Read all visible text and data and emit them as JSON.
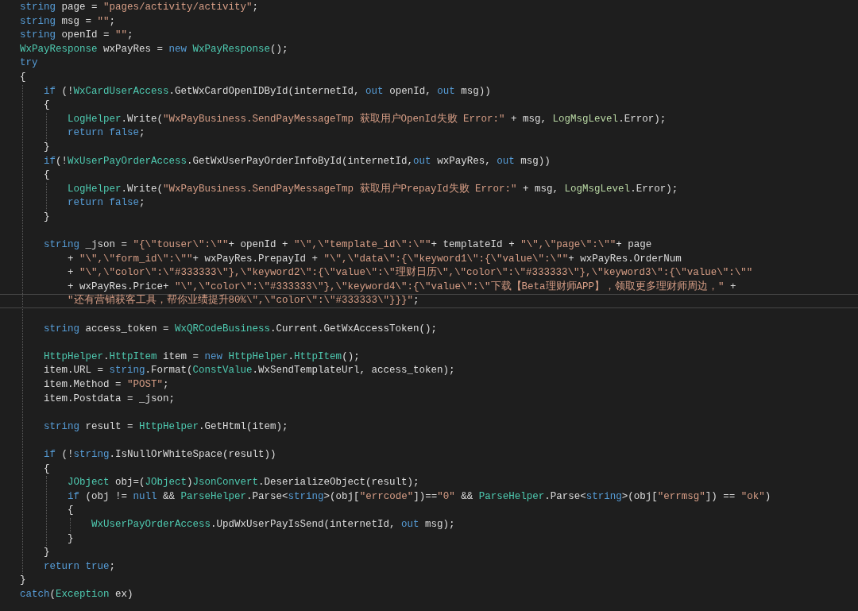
{
  "editor": {
    "lines": [
      {
        "kind": "code",
        "tokens": [
          {
            "kind": "kw",
            "text": "string"
          },
          {
            "kind": "plain",
            "text": " page = "
          },
          {
            "kind": "str",
            "text": "\"pages/activity/activity\""
          },
          {
            "kind": "plain",
            "text": ";"
          }
        ]
      },
      {
        "kind": "code",
        "tokens": [
          {
            "kind": "kw",
            "text": "string"
          },
          {
            "kind": "plain",
            "text": " msg = "
          },
          {
            "kind": "str",
            "text": "\"\""
          },
          {
            "kind": "plain",
            "text": ";"
          }
        ]
      },
      {
        "kind": "code",
        "tokens": [
          {
            "kind": "kw",
            "text": "string"
          },
          {
            "kind": "plain",
            "text": " openId = "
          },
          {
            "kind": "str",
            "text": "\"\""
          },
          {
            "kind": "plain",
            "text": ";"
          }
        ]
      },
      {
        "kind": "code",
        "tokens": [
          {
            "kind": "type",
            "text": "WxPayResponse"
          },
          {
            "kind": "plain",
            "text": " wxPayRes = "
          },
          {
            "kind": "kw",
            "text": "new "
          },
          {
            "kind": "type",
            "text": "WxPayResponse"
          },
          {
            "kind": "plain",
            "text": "();"
          }
        ]
      },
      {
        "kind": "code",
        "tokens": [
          {
            "kind": "kw",
            "text": "try"
          }
        ]
      },
      {
        "kind": "code",
        "tokens": [
          {
            "kind": "plain",
            "text": "{"
          }
        ],
        "guide": true,
        "children": [
          {
            "kind": "code",
            "tokens": [
              {
                "kind": "kw",
                "text": "if"
              },
              {
                "kind": "plain",
                "text": " (!"
              },
              {
                "kind": "type",
                "text": "WxCardUserAccess"
              },
              {
                "kind": "plain",
                "text": ".GetWxCardOpenIDById(internetId, "
              },
              {
                "kind": "kw",
                "text": "out"
              },
              {
                "kind": "plain",
                "text": " openId, "
              },
              {
                "kind": "kw",
                "text": "out"
              },
              {
                "kind": "plain",
                "text": " msg))"
              }
            ]
          },
          {
            "kind": "code",
            "tokens": [
              {
                "kind": "plain",
                "text": "{"
              }
            ],
            "guide": true,
            "children": [
              {
                "kind": "code",
                "tokens": [
                  {
                    "kind": "type",
                    "text": "LogHelper"
                  },
                  {
                    "kind": "plain",
                    "text": ".Write("
                  },
                  {
                    "kind": "str",
                    "text": "\"WxPayBusiness.SendPayMessageTmp 获取用户OpenId失败 Error:\""
                  },
                  {
                    "kind": "plain",
                    "text": " + msg, "
                  },
                  {
                    "kind": "enum",
                    "text": "LogMsgLevel"
                  },
                  {
                    "kind": "plain",
                    "text": ".Error);"
                  }
                ]
              },
              {
                "kind": "code",
                "tokens": [
                  {
                    "kind": "kw",
                    "text": "return false"
                  },
                  {
                    "kind": "plain",
                    "text": ";"
                  }
                ]
              }
            ]
          },
          {
            "kind": "code",
            "tokens": [
              {
                "kind": "plain",
                "text": "}"
              }
            ]
          },
          {
            "kind": "code",
            "tokens": [
              {
                "kind": "kw",
                "text": "if"
              },
              {
                "kind": "plain",
                "text": "(!"
              },
              {
                "kind": "type",
                "text": "WxUserPayOrderAccess"
              },
              {
                "kind": "plain",
                "text": ".GetWxUserPayOrderInfoById(internetId,"
              },
              {
                "kind": "kw",
                "text": "out"
              },
              {
                "kind": "plain",
                "text": " wxPayRes, "
              },
              {
                "kind": "kw",
                "text": "out"
              },
              {
                "kind": "plain",
                "text": " msg))"
              }
            ]
          },
          {
            "kind": "code",
            "tokens": [
              {
                "kind": "plain",
                "text": "{"
              }
            ],
            "guide": true,
            "children": [
              {
                "kind": "code",
                "tokens": [
                  {
                    "kind": "type",
                    "text": "LogHelper"
                  },
                  {
                    "kind": "plain",
                    "text": ".Write("
                  },
                  {
                    "kind": "str",
                    "text": "\"WxPayBusiness.SendPayMessageTmp 获取用户PrepayId失败 Error:\""
                  },
                  {
                    "kind": "plain",
                    "text": " + msg, "
                  },
                  {
                    "kind": "enum",
                    "text": "LogMsgLevel"
                  },
                  {
                    "kind": "plain",
                    "text": ".Error);"
                  }
                ]
              },
              {
                "kind": "code",
                "tokens": [
                  {
                    "kind": "kw",
                    "text": "return false"
                  },
                  {
                    "kind": "plain",
                    "text": ";"
                  }
                ]
              }
            ]
          },
          {
            "kind": "code",
            "tokens": [
              {
                "kind": "plain",
                "text": "}"
              }
            ]
          },
          {
            "kind": "blank"
          },
          {
            "kind": "code",
            "tokens": [
              {
                "kind": "kw",
                "text": "string"
              },
              {
                "kind": "plain",
                "text": " _json = "
              },
              {
                "kind": "str",
                "text": "\"{\\\"touser\\\":\\\"\""
              },
              {
                "kind": "plain",
                "text": "+ openId + "
              },
              {
                "kind": "str",
                "text": "\"\\\",\\\"template_id\\\":\\\"\""
              },
              {
                "kind": "plain",
                "text": "+ templateId + "
              },
              {
                "kind": "str",
                "text": "\"\\\",\\\"page\\\":\\\"\""
              },
              {
                "kind": "plain",
                "text": "+ page"
              }
            ],
            "guide": false,
            "children": [
              {
                "kind": "code",
                "tokens": [
                  {
                    "kind": "plain",
                    "text": "+ "
                  },
                  {
                    "kind": "str",
                    "text": "\"\\\",\\\"form_id\\\":\\\"\""
                  },
                  {
                    "kind": "plain",
                    "text": "+ wxPayRes.PrepayId + "
                  },
                  {
                    "kind": "str",
                    "text": "\"\\\",\\\"data\\\":{\\\"keyword1\\\":{\\\"value\\\":\\\"\""
                  },
                  {
                    "kind": "plain",
                    "text": "+ wxPayRes.OrderNum"
                  }
                ]
              },
              {
                "kind": "code",
                "tokens": [
                  {
                    "kind": "plain",
                    "text": "+ "
                  },
                  {
                    "kind": "str",
                    "text": "\"\\\",\\\"color\\\":\\\"#333333\\\"},\\\"keyword2\\\":{\\\"value\\\":\\\"理财日历\\\",\\\"color\\\":\\\"#333333\\\"},\\\"keyword3\\\":{\\\"value\\\":\\\"\""
                  }
                ]
              },
              {
                "kind": "code",
                "tokens": [
                  {
                    "kind": "plain",
                    "text": "+ wxPayRes.Price+ "
                  },
                  {
                    "kind": "str",
                    "text": "\"\\\",\\\"color\\\":\\\"#333333\\\"},\\\"keyword4\\\":{\\\"value\\\":\\\"下载【Beta理财师APP】，领取更多理财师周边，\""
                  },
                  {
                    "kind": "plain",
                    "text": " +"
                  }
                ]
              },
              {
                "kind": "code",
                "current": true,
                "tokens": [
                  {
                    "kind": "str",
                    "text": "\"还有营销获客工具，帮你业绩提升80%\\\",\\\"color\\\":\\\"#333333\\\"}}}\""
                  },
                  {
                    "kind": "plain",
                    "text": ";"
                  }
                ]
              }
            ]
          },
          {
            "kind": "blank"
          },
          {
            "kind": "code",
            "tokens": [
              {
                "kind": "kw",
                "text": "string"
              },
              {
                "kind": "plain",
                "text": " access_token = "
              },
              {
                "kind": "type",
                "text": "WxQRCodeBusiness"
              },
              {
                "kind": "plain",
                "text": ".Current.GetWxAccessToken();"
              }
            ]
          },
          {
            "kind": "blank"
          },
          {
            "kind": "code",
            "tokens": [
              {
                "kind": "type",
                "text": "HttpHelper"
              },
              {
                "kind": "plain",
                "text": "."
              },
              {
                "kind": "type",
                "text": "HttpItem"
              },
              {
                "kind": "plain",
                "text": " item = "
              },
              {
                "kind": "kw",
                "text": "new "
              },
              {
                "kind": "type",
                "text": "HttpHelper"
              },
              {
                "kind": "plain",
                "text": "."
              },
              {
                "kind": "type",
                "text": "HttpItem"
              },
              {
                "kind": "plain",
                "text": "();"
              }
            ]
          },
          {
            "kind": "code",
            "tokens": [
              {
                "kind": "plain",
                "text": "item.URL = "
              },
              {
                "kind": "kw",
                "text": "string"
              },
              {
                "kind": "plain",
                "text": ".Format("
              },
              {
                "kind": "type",
                "text": "ConstValue"
              },
              {
                "kind": "plain",
                "text": ".WxSendTemplateUrl, access_token);"
              }
            ]
          },
          {
            "kind": "code",
            "tokens": [
              {
                "kind": "plain",
                "text": "item.Method = "
              },
              {
                "kind": "str",
                "text": "\"POST\""
              },
              {
                "kind": "plain",
                "text": ";"
              }
            ]
          },
          {
            "kind": "code",
            "tokens": [
              {
                "kind": "plain",
                "text": "item.Postdata = _json;"
              }
            ]
          },
          {
            "kind": "blank"
          },
          {
            "kind": "code",
            "tokens": [
              {
                "kind": "kw",
                "text": "string"
              },
              {
                "kind": "plain",
                "text": " result = "
              },
              {
                "kind": "type",
                "text": "HttpHelper"
              },
              {
                "kind": "plain",
                "text": ".GetHtml(item);"
              }
            ]
          },
          {
            "kind": "blank"
          },
          {
            "kind": "code",
            "tokens": [
              {
                "kind": "kw",
                "text": "if"
              },
              {
                "kind": "plain",
                "text": " (!"
              },
              {
                "kind": "kw",
                "text": "string"
              },
              {
                "kind": "plain",
                "text": ".IsNullOrWhiteSpace(result))"
              }
            ]
          },
          {
            "kind": "code",
            "tokens": [
              {
                "kind": "plain",
                "text": "{"
              }
            ],
            "guide": true,
            "children": [
              {
                "kind": "code",
                "tokens": [
                  {
                    "kind": "type",
                    "text": "JObject"
                  },
                  {
                    "kind": "plain",
                    "text": " obj=("
                  },
                  {
                    "kind": "type",
                    "text": "JObject"
                  },
                  {
                    "kind": "plain",
                    "text": ")"
                  },
                  {
                    "kind": "type",
                    "text": "JsonConvert"
                  },
                  {
                    "kind": "plain",
                    "text": ".DeserializeObject(result);"
                  }
                ]
              },
              {
                "kind": "code",
                "tokens": [
                  {
                    "kind": "kw",
                    "text": "if"
                  },
                  {
                    "kind": "plain",
                    "text": " (obj != "
                  },
                  {
                    "kind": "kw",
                    "text": "null"
                  },
                  {
                    "kind": "plain",
                    "text": " && "
                  },
                  {
                    "kind": "type",
                    "text": "ParseHelper"
                  },
                  {
                    "kind": "plain",
                    "text": ".Parse<"
                  },
                  {
                    "kind": "kw",
                    "text": "string"
                  },
                  {
                    "kind": "plain",
                    "text": ">(obj["
                  },
                  {
                    "kind": "str",
                    "text": "\"errcode\""
                  },
                  {
                    "kind": "plain",
                    "text": "])=="
                  },
                  {
                    "kind": "str",
                    "text": "\"0\""
                  },
                  {
                    "kind": "plain",
                    "text": " && "
                  },
                  {
                    "kind": "type",
                    "text": "ParseHelper"
                  },
                  {
                    "kind": "plain",
                    "text": ".Parse<"
                  },
                  {
                    "kind": "kw",
                    "text": "string"
                  },
                  {
                    "kind": "plain",
                    "text": ">(obj["
                  },
                  {
                    "kind": "str",
                    "text": "\"errmsg\""
                  },
                  {
                    "kind": "plain",
                    "text": "]) == "
                  },
                  {
                    "kind": "str",
                    "text": "\"ok\""
                  },
                  {
                    "kind": "plain",
                    "text": ")"
                  }
                ]
              },
              {
                "kind": "code",
                "tokens": [
                  {
                    "kind": "plain",
                    "text": "{"
                  }
                ],
                "guide": true,
                "children": [
                  {
                    "kind": "code",
                    "tokens": [
                      {
                        "kind": "type",
                        "text": "WxUserPayOrderAccess"
                      },
                      {
                        "kind": "plain",
                        "text": ".UpdWxUserPayIsSend(internetId, "
                      },
                      {
                        "kind": "kw",
                        "text": "out"
                      },
                      {
                        "kind": "plain",
                        "text": " msg);"
                      }
                    ]
                  }
                ]
              },
              {
                "kind": "code",
                "tokens": [
                  {
                    "kind": "plain",
                    "text": "}"
                  }
                ]
              }
            ]
          },
          {
            "kind": "code",
            "tokens": [
              {
                "kind": "plain",
                "text": "}"
              }
            ]
          },
          {
            "kind": "code",
            "tokens": [
              {
                "kind": "kw",
                "text": "return true"
              },
              {
                "kind": "plain",
                "text": ";"
              }
            ]
          }
        ]
      },
      {
        "kind": "code",
        "tokens": [
          {
            "kind": "plain",
            "text": "}"
          }
        ]
      },
      {
        "kind": "code",
        "tokens": [
          {
            "kind": "kw",
            "text": "catch"
          },
          {
            "kind": "plain",
            "text": "("
          },
          {
            "kind": "type",
            "text": "Exception"
          },
          {
            "kind": "plain",
            "text": " ex)"
          }
        ]
      }
    ]
  }
}
